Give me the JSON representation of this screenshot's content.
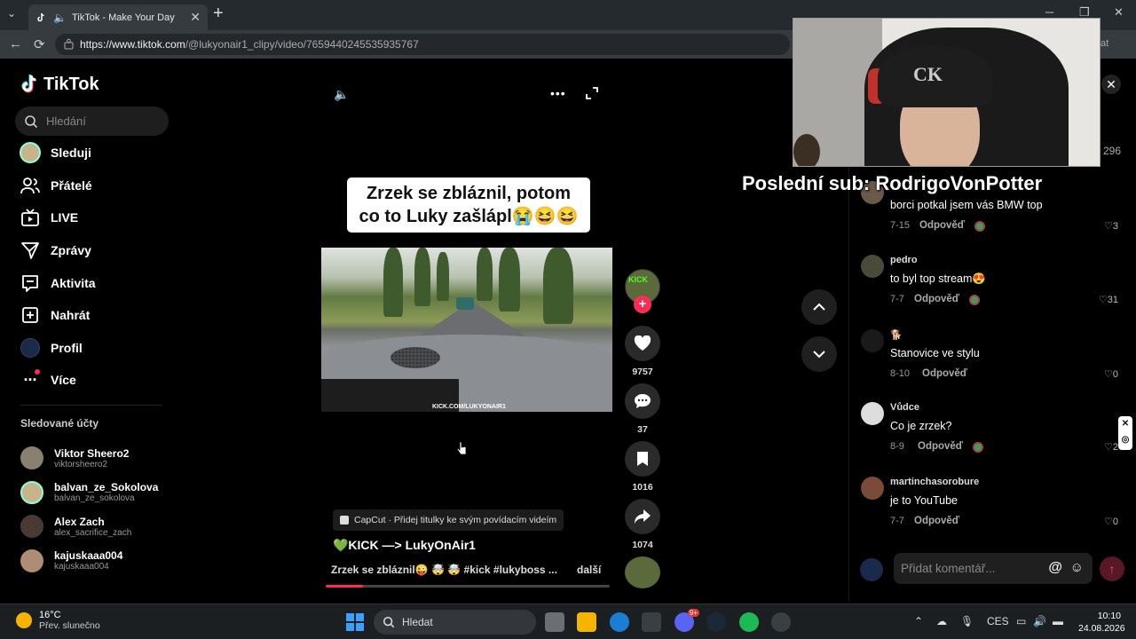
{
  "browser": {
    "tab_title": "TikTok - Make Your Day",
    "url_host": "https://www.tiktok.com",
    "url_path": "/@lukyonair1_clipy/video/7659440245535935767",
    "addr_right_text": "at"
  },
  "sidebar": {
    "logo_text": "TikTok",
    "search_placeholder": "Hledání",
    "items": [
      {
        "label": "Sleduji"
      },
      {
        "label": "Přátelé"
      },
      {
        "label": "LIVE"
      },
      {
        "label": "Zprávy"
      },
      {
        "label": "Aktivita"
      },
      {
        "label": "Nahrát"
      },
      {
        "label": "Profil"
      },
      {
        "label": "Více"
      }
    ],
    "following_title": "Sledované účty",
    "following": [
      {
        "name": "Viktor Sheero2",
        "username": "viktorsheero2"
      },
      {
        "name": "balvan_ze_Sokolova",
        "username": "balvan_ze_sokolova"
      },
      {
        "name": "Alex Zach",
        "username": "alex_sacrifice_zach"
      },
      {
        "name": "kajuskaaa004",
        "username": "kajuskaaa004"
      }
    ]
  },
  "video": {
    "caption_line1": "Zrzek se zbláznil, potom",
    "caption_line2": "co to Luky zašlápl😭😆😆",
    "overlay_tag": "KICK.COM/LUKYONAIR1",
    "capcut_text": "CapCut · Přidej titulky ke svým povídacím videím",
    "title": "💚KICK —> LukyOnAir1",
    "description": "Zrzek se zbláznil😜 🤯 🤯 #kick #lukyboss ...",
    "more_label": "další",
    "progress": 0.13,
    "author_badge": "KICK"
  },
  "actions": {
    "likes": "9757",
    "comments": "37",
    "saves": "1016",
    "shares": "1074"
  },
  "comments_panel": {
    "top_count": "296",
    "items": [
      {
        "author": "",
        "text": "borci potkal jsem vás BMW top",
        "date": "7-15",
        "reply": "Odpověď",
        "likes": "3"
      },
      {
        "author": "pedro",
        "text": "to byl top stream😍",
        "date": "7-7",
        "reply": "Odpověď",
        "likes": "31"
      },
      {
        "author": "🐕",
        "text": "Stanovice ve stylu",
        "date": "8-10",
        "reply": "Odpověď",
        "likes": "0"
      },
      {
        "author": "Vůdce",
        "text": "Co je zrzek?",
        "date": "8-9",
        "reply": "Odpověď",
        "likes": "2"
      },
      {
        "author": "martinchasorobure",
        "text": "je to YouTube",
        "date": "7-7",
        "reply": "Odpověď",
        "likes": "0"
      }
    ],
    "input_placeholder": "Přidat komentář..."
  },
  "stream_overlay": {
    "sub_text": "Poslední sub: RodrigoVonPotter"
  },
  "taskbar": {
    "temp": "16°C",
    "weather": "Přev. slunečno",
    "search": "Hledat",
    "lang": "CES",
    "time": "10:10",
    "date": "24.08.2026",
    "discord_badge": "9+"
  },
  "colors": {
    "accent": "#fe2c55",
    "kick_green": "#53fc18",
    "taskbar_bg": "#1c1f22"
  }
}
